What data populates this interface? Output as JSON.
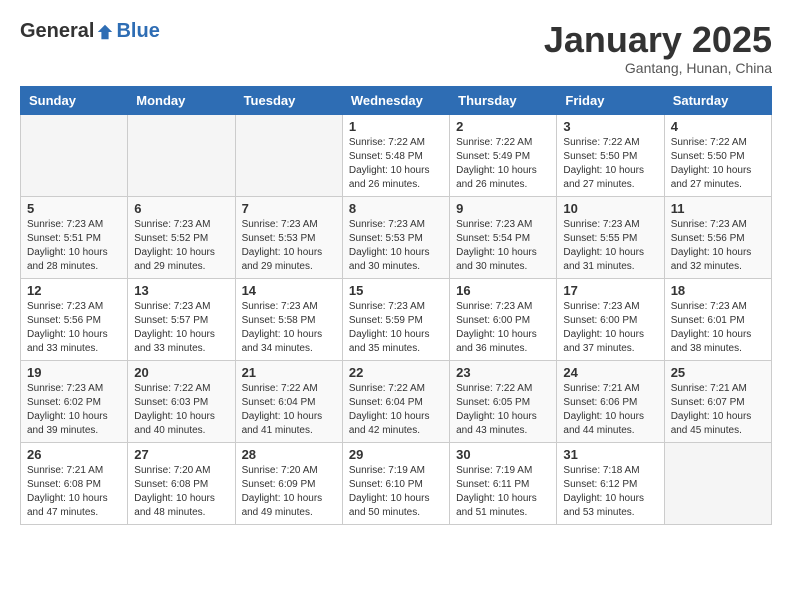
{
  "header": {
    "logo_general": "General",
    "logo_blue": "Blue",
    "month_year": "January 2025",
    "location": "Gantang, Hunan, China"
  },
  "weekdays": [
    "Sunday",
    "Monday",
    "Tuesday",
    "Wednesday",
    "Thursday",
    "Friday",
    "Saturday"
  ],
  "weeks": [
    [
      {
        "day": "",
        "sunrise": "",
        "sunset": "",
        "daylight": ""
      },
      {
        "day": "",
        "sunrise": "",
        "sunset": "",
        "daylight": ""
      },
      {
        "day": "",
        "sunrise": "",
        "sunset": "",
        "daylight": ""
      },
      {
        "day": "1",
        "sunrise": "Sunrise: 7:22 AM",
        "sunset": "Sunset: 5:48 PM",
        "daylight": "Daylight: 10 hours and 26 minutes."
      },
      {
        "day": "2",
        "sunrise": "Sunrise: 7:22 AM",
        "sunset": "Sunset: 5:49 PM",
        "daylight": "Daylight: 10 hours and 26 minutes."
      },
      {
        "day": "3",
        "sunrise": "Sunrise: 7:22 AM",
        "sunset": "Sunset: 5:50 PM",
        "daylight": "Daylight: 10 hours and 27 minutes."
      },
      {
        "day": "4",
        "sunrise": "Sunrise: 7:22 AM",
        "sunset": "Sunset: 5:50 PM",
        "daylight": "Daylight: 10 hours and 27 minutes."
      }
    ],
    [
      {
        "day": "5",
        "sunrise": "Sunrise: 7:23 AM",
        "sunset": "Sunset: 5:51 PM",
        "daylight": "Daylight: 10 hours and 28 minutes."
      },
      {
        "day": "6",
        "sunrise": "Sunrise: 7:23 AM",
        "sunset": "Sunset: 5:52 PM",
        "daylight": "Daylight: 10 hours and 29 minutes."
      },
      {
        "day": "7",
        "sunrise": "Sunrise: 7:23 AM",
        "sunset": "Sunset: 5:53 PM",
        "daylight": "Daylight: 10 hours and 29 minutes."
      },
      {
        "day": "8",
        "sunrise": "Sunrise: 7:23 AM",
        "sunset": "Sunset: 5:53 PM",
        "daylight": "Daylight: 10 hours and 30 minutes."
      },
      {
        "day": "9",
        "sunrise": "Sunrise: 7:23 AM",
        "sunset": "Sunset: 5:54 PM",
        "daylight": "Daylight: 10 hours and 30 minutes."
      },
      {
        "day": "10",
        "sunrise": "Sunrise: 7:23 AM",
        "sunset": "Sunset: 5:55 PM",
        "daylight": "Daylight: 10 hours and 31 minutes."
      },
      {
        "day": "11",
        "sunrise": "Sunrise: 7:23 AM",
        "sunset": "Sunset: 5:56 PM",
        "daylight": "Daylight: 10 hours and 32 minutes."
      }
    ],
    [
      {
        "day": "12",
        "sunrise": "Sunrise: 7:23 AM",
        "sunset": "Sunset: 5:56 PM",
        "daylight": "Daylight: 10 hours and 33 minutes."
      },
      {
        "day": "13",
        "sunrise": "Sunrise: 7:23 AM",
        "sunset": "Sunset: 5:57 PM",
        "daylight": "Daylight: 10 hours and 33 minutes."
      },
      {
        "day": "14",
        "sunrise": "Sunrise: 7:23 AM",
        "sunset": "Sunset: 5:58 PM",
        "daylight": "Daylight: 10 hours and 34 minutes."
      },
      {
        "day": "15",
        "sunrise": "Sunrise: 7:23 AM",
        "sunset": "Sunset: 5:59 PM",
        "daylight": "Daylight: 10 hours and 35 minutes."
      },
      {
        "day": "16",
        "sunrise": "Sunrise: 7:23 AM",
        "sunset": "Sunset: 6:00 PM",
        "daylight": "Daylight: 10 hours and 36 minutes."
      },
      {
        "day": "17",
        "sunrise": "Sunrise: 7:23 AM",
        "sunset": "Sunset: 6:00 PM",
        "daylight": "Daylight: 10 hours and 37 minutes."
      },
      {
        "day": "18",
        "sunrise": "Sunrise: 7:23 AM",
        "sunset": "Sunset: 6:01 PM",
        "daylight": "Daylight: 10 hours and 38 minutes."
      }
    ],
    [
      {
        "day": "19",
        "sunrise": "Sunrise: 7:23 AM",
        "sunset": "Sunset: 6:02 PM",
        "daylight": "Daylight: 10 hours and 39 minutes."
      },
      {
        "day": "20",
        "sunrise": "Sunrise: 7:22 AM",
        "sunset": "Sunset: 6:03 PM",
        "daylight": "Daylight: 10 hours and 40 minutes."
      },
      {
        "day": "21",
        "sunrise": "Sunrise: 7:22 AM",
        "sunset": "Sunset: 6:04 PM",
        "daylight": "Daylight: 10 hours and 41 minutes."
      },
      {
        "day": "22",
        "sunrise": "Sunrise: 7:22 AM",
        "sunset": "Sunset: 6:04 PM",
        "daylight": "Daylight: 10 hours and 42 minutes."
      },
      {
        "day": "23",
        "sunrise": "Sunrise: 7:22 AM",
        "sunset": "Sunset: 6:05 PM",
        "daylight": "Daylight: 10 hours and 43 minutes."
      },
      {
        "day": "24",
        "sunrise": "Sunrise: 7:21 AM",
        "sunset": "Sunset: 6:06 PM",
        "daylight": "Daylight: 10 hours and 44 minutes."
      },
      {
        "day": "25",
        "sunrise": "Sunrise: 7:21 AM",
        "sunset": "Sunset: 6:07 PM",
        "daylight": "Daylight: 10 hours and 45 minutes."
      }
    ],
    [
      {
        "day": "26",
        "sunrise": "Sunrise: 7:21 AM",
        "sunset": "Sunset: 6:08 PM",
        "daylight": "Daylight: 10 hours and 47 minutes."
      },
      {
        "day": "27",
        "sunrise": "Sunrise: 7:20 AM",
        "sunset": "Sunset: 6:08 PM",
        "daylight": "Daylight: 10 hours and 48 minutes."
      },
      {
        "day": "28",
        "sunrise": "Sunrise: 7:20 AM",
        "sunset": "Sunset: 6:09 PM",
        "daylight": "Daylight: 10 hours and 49 minutes."
      },
      {
        "day": "29",
        "sunrise": "Sunrise: 7:19 AM",
        "sunset": "Sunset: 6:10 PM",
        "daylight": "Daylight: 10 hours and 50 minutes."
      },
      {
        "day": "30",
        "sunrise": "Sunrise: 7:19 AM",
        "sunset": "Sunset: 6:11 PM",
        "daylight": "Daylight: 10 hours and 51 minutes."
      },
      {
        "day": "31",
        "sunrise": "Sunrise: 7:18 AM",
        "sunset": "Sunset: 6:12 PM",
        "daylight": "Daylight: 10 hours and 53 minutes."
      },
      {
        "day": "",
        "sunrise": "",
        "sunset": "",
        "daylight": ""
      }
    ]
  ]
}
